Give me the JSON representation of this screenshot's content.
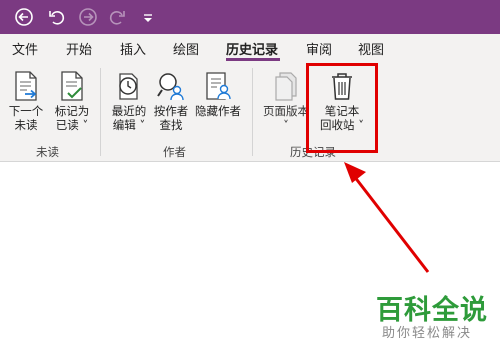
{
  "titlebar": {
    "bg_color": "#7b3a82",
    "quick_access": [
      {
        "name": "back-icon"
      },
      {
        "name": "undo-icon"
      },
      {
        "name": "forward-icon"
      },
      {
        "name": "redo-icon"
      },
      {
        "name": "customize-quick-access-icon"
      }
    ]
  },
  "tabs": [
    "文件",
    "开始",
    "插入",
    "绘图",
    "历史记录",
    "审阅",
    "视图"
  ],
  "active_tab": "历史记录",
  "ribbon": {
    "groups": [
      {
        "label": "未读",
        "commands": [
          {
            "line1": "下一个",
            "line2": "未读",
            "icon": "next-unread-icon"
          },
          {
            "line1": "标记为",
            "line2": "已读 ˅",
            "icon": "mark-as-read-icon"
          }
        ]
      },
      {
        "label": "作者",
        "commands": [
          {
            "line1": "最近的",
            "line2": "编辑 ˅",
            "icon": "recent-edits-icon"
          },
          {
            "line1": "按作者",
            "line2": "查找",
            "icon": "find-by-author-icon"
          },
          {
            "line1": "隐藏作者",
            "line2": "",
            "icon": "hide-authors-icon"
          }
        ]
      },
      {
        "label": "历史记录",
        "commands": [
          {
            "line1": "页面版本",
            "line2": "˅",
            "icon": "page-versions-icon"
          },
          {
            "line1": "笔记本",
            "line2": "回收站 ˅",
            "icon": "notebook-recycle-bin-icon"
          }
        ]
      }
    ]
  },
  "annotation": {
    "highlight_color": "#e00000",
    "arrow_color": "#e00000"
  },
  "watermark": {
    "title": "百科全说",
    "subtitle": "助你轻松解决",
    "title_color": "#2e9b3a"
  }
}
